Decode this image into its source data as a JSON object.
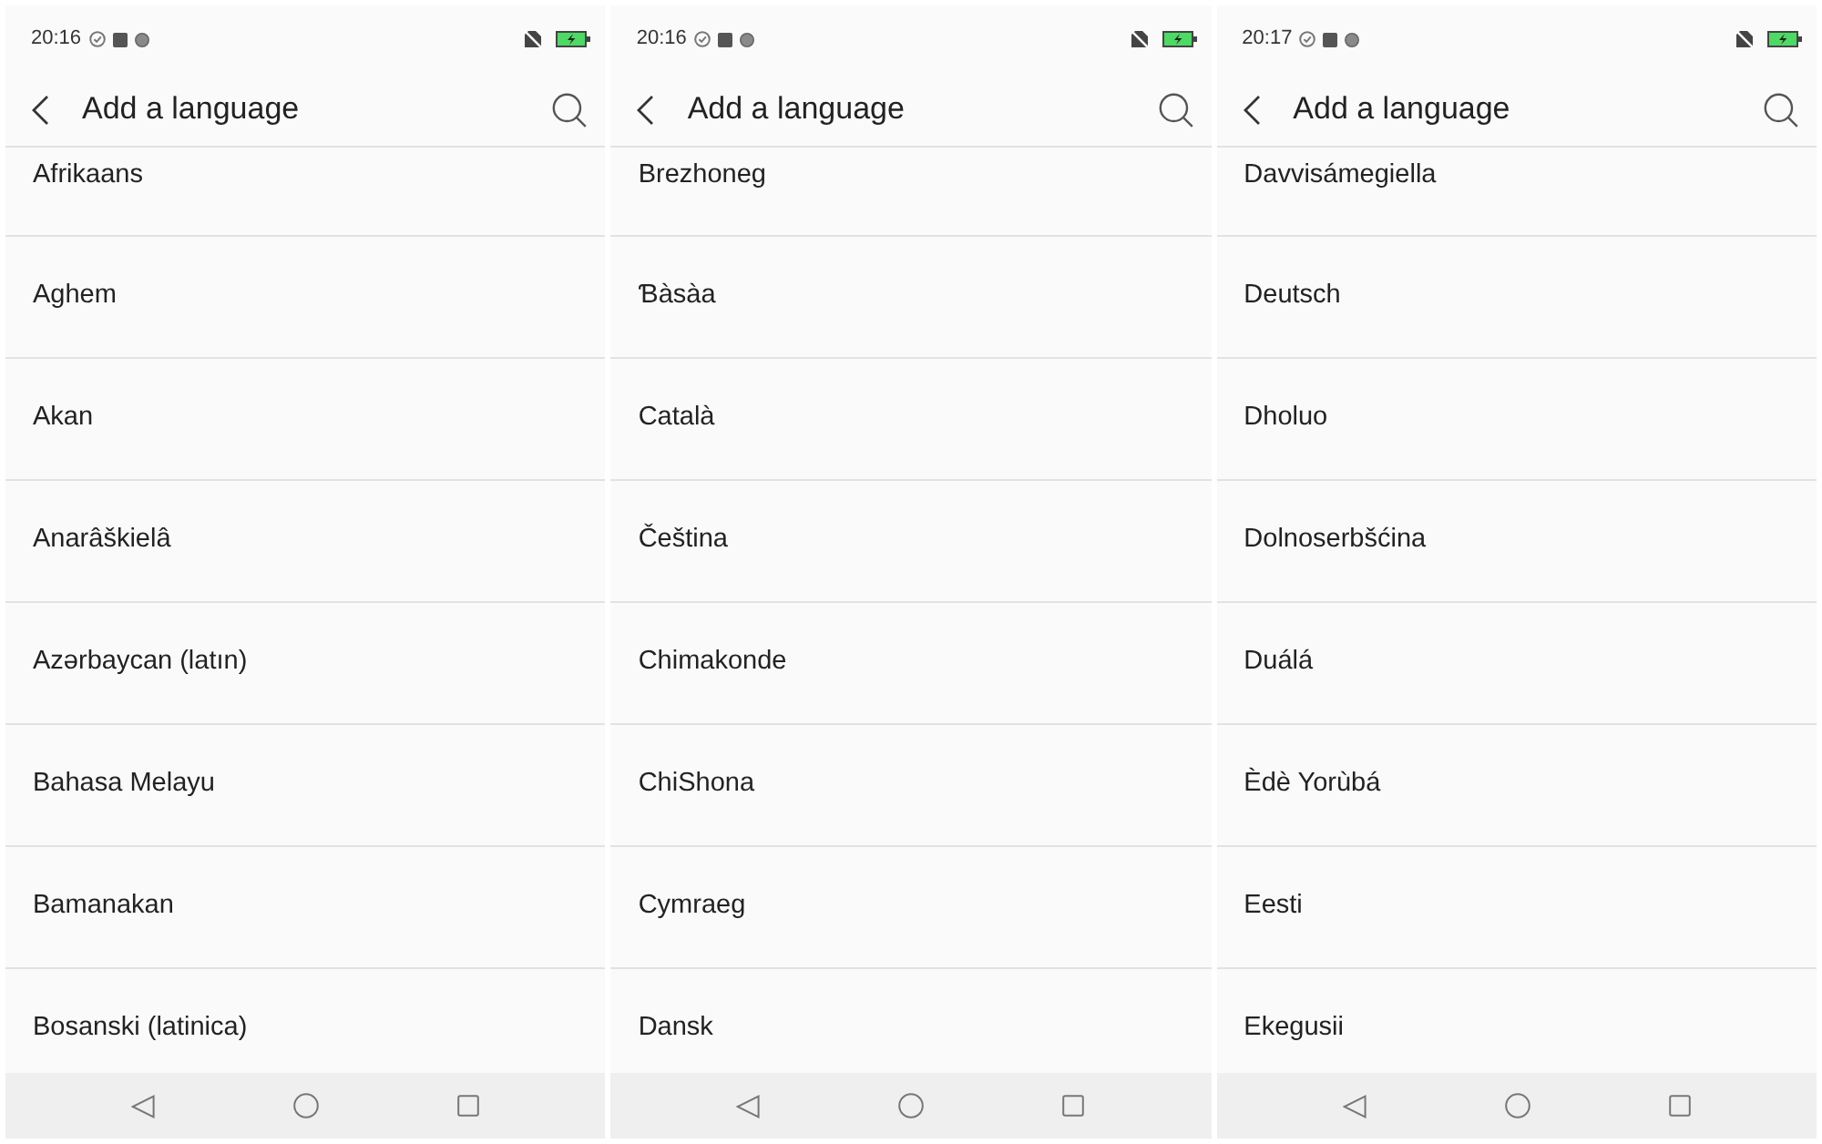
{
  "screens": [
    {
      "status_bar": {
        "time": "20:16"
      },
      "header": {
        "title": "Add a language"
      },
      "languages": [
        "Afrikaans",
        "Aghem",
        "Akan",
        "Anarâškielâ",
        "Azərbaycan (latın)",
        "Bahasa Melayu",
        "Bamanakan",
        "Bosanski (latinica)"
      ]
    },
    {
      "status_bar": {
        "time": "20:16"
      },
      "header": {
        "title": "Add a language"
      },
      "languages": [
        "Brezhoneg",
        "Ɓàsàa",
        "Català",
        "Čeština",
        "Chimakonde",
        "ChiShona",
        "Cymraeg",
        "Dansk"
      ]
    },
    {
      "status_bar": {
        "time": "20:17"
      },
      "header": {
        "title": "Add a language"
      },
      "languages": [
        "Davvisámegiella",
        "Deutsch",
        "Dholuo",
        "Dolnoserbšćina",
        "Duálá",
        "Èdè Yorùbá",
        "Eesti",
        "Ekegusii"
      ]
    }
  ]
}
